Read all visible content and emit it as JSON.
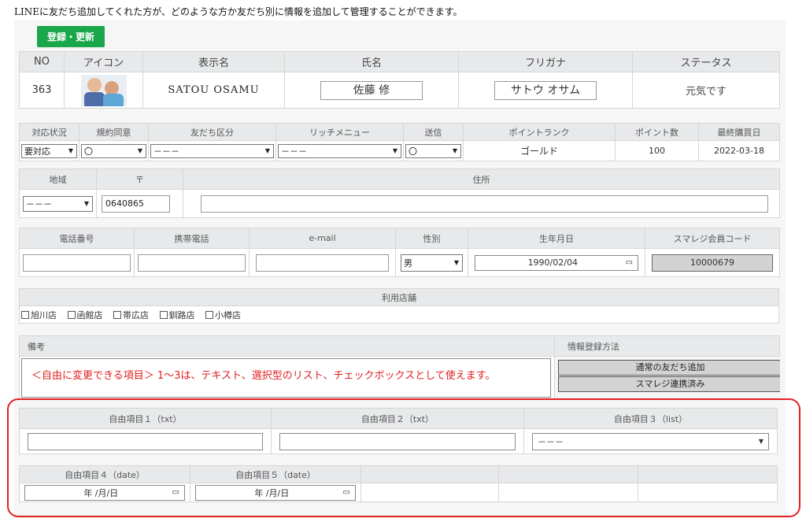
{
  "intro": "LINEに友だち追加してくれた方が、どのような方か友だち別に情報を追加して管理することができます。",
  "toolbar": {
    "register_label": "登録・更新"
  },
  "basic": {
    "headers": {
      "no": "NO",
      "icon": "アイコン",
      "display_name": "表示名",
      "full_name": "氏名",
      "furigana": "フリガナ",
      "status": "ステータス"
    },
    "no": "363",
    "display_name": "SATOU OSAMU",
    "full_name": "佐藤 修",
    "furigana": "サトウ オサム",
    "status": "元気です"
  },
  "service": {
    "headers": {
      "response": "対応状況",
      "consent": "規約同意",
      "friend_type": "友だち区分",
      "rich_menu": "リッチメニュー",
      "send": "送信",
      "point_rank": "ポイントランク",
      "points": "ポイント数",
      "last_purchase": "最終購買日"
    },
    "response": "要対応",
    "consent": "〇",
    "friend_type": "－－－",
    "rich_menu": "－－－",
    "send": "〇",
    "point_rank": "ゴールド",
    "points": "100",
    "last_purchase": "2022-03-18"
  },
  "address": {
    "headers": {
      "region": "地域",
      "postal": "〒",
      "address": "住所"
    },
    "region": "－－－",
    "postal": "0640865",
    "address": ""
  },
  "contact": {
    "headers": {
      "phone": "電話番号",
      "mobile": "携帯電話",
      "email": "e-mail",
      "gender": "性別",
      "birthday": "生年月日",
      "smaregi_code": "スマレジ会員コード"
    },
    "phone": "",
    "mobile": "",
    "email": "",
    "gender": "男",
    "birthday": "1990/02/04",
    "smaregi_code": "10000679"
  },
  "stores": {
    "header": "利用店舗",
    "items": [
      {
        "label": "旭川店",
        "checked": false
      },
      {
        "label": "函館店",
        "checked": false
      },
      {
        "label": "帯広店",
        "checked": false
      },
      {
        "label": "釧路店",
        "checked": false
      },
      {
        "label": "小樽店",
        "checked": false
      }
    ]
  },
  "notes": {
    "header": "備考",
    "text": "＜自由に変更できる項目＞ 1～3は、テキスト、選択型のリスト、チェックボックスとして使えます。"
  },
  "registration": {
    "header": "情報登録方法",
    "buttons": [
      "通常の友だち追加",
      "スマレジ連携済み"
    ]
  },
  "free_fields": {
    "field1_label": "自由項目１（txt）",
    "field2_label": "自由項目２（txt）",
    "field3_label": "自由項目３（list）",
    "field3_value": "－－－",
    "field4_label": "自由項目４（date）",
    "field5_label": "自由項目５（date）",
    "date_placeholder": "年 /月/日"
  },
  "colors": {
    "accent_green": "#1aa64a",
    "highlight_red": "#e0201f"
  },
  "icons": {
    "dropdown": "chevron-down-icon",
    "calendar": "calendar-icon",
    "checkbox": "checkbox-icon"
  }
}
